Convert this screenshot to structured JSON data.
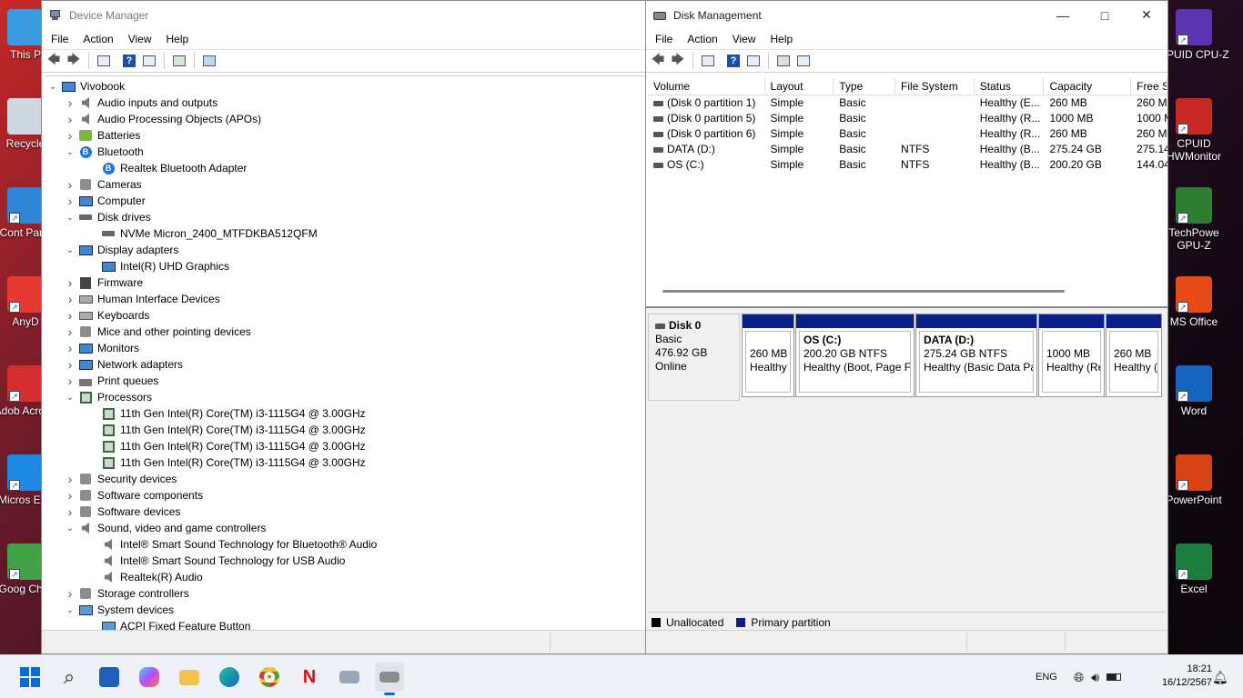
{
  "desktop": {
    "left_icons": [
      {
        "label": "This P",
        "color": "#3a9be0"
      },
      {
        "label": "Recycle",
        "color": "#cfd8e0"
      },
      {
        "label": "Cont Pane",
        "color": "#2f86d6"
      },
      {
        "label": "AnyD",
        "color": "#e53935"
      },
      {
        "label": "Adob Acroba",
        "color": "#d32f2f"
      },
      {
        "label": "Micros Edg",
        "color": "#1e88e5"
      },
      {
        "label": "Goog Chro",
        "color": "#43a047"
      }
    ],
    "right_icons": [
      {
        "label": "CPUID CPU-Z",
        "color": "#5e35b1"
      },
      {
        "label": "CPUID HWMonitor",
        "color": "#c62828"
      },
      {
        "label": "TechPowe GPU-Z",
        "color": "#2e7d32"
      },
      {
        "label": "MS Office",
        "color": "#e64a19"
      },
      {
        "label": "Word",
        "color": "#1565c0"
      },
      {
        "label": "PowerPoint",
        "color": "#d84315"
      },
      {
        "label": "Excel",
        "color": "#1b7d3e"
      }
    ]
  },
  "device_manager": {
    "title": "Device Manager",
    "menu": [
      "File",
      "Action",
      "View",
      "Help"
    ],
    "tree": [
      {
        "label": "Vivobook",
        "level": 0,
        "expanded": true,
        "icon": "computer"
      },
      {
        "label": "Audio inputs and outputs",
        "level": 1,
        "expanded": false,
        "icon": "speaker"
      },
      {
        "label": "Audio Processing Objects (APOs)",
        "level": 1,
        "expanded": false,
        "icon": "speaker"
      },
      {
        "label": "Batteries",
        "level": 1,
        "expanded": false,
        "icon": "battery"
      },
      {
        "label": "Bluetooth",
        "level": 1,
        "expanded": true,
        "icon": "bluetooth"
      },
      {
        "label": "Realtek Bluetooth Adapter",
        "level": 2,
        "icon": "bluetooth"
      },
      {
        "label": "Cameras",
        "level": 1,
        "expanded": false,
        "icon": "gray"
      },
      {
        "label": "Computer",
        "level": 1,
        "expanded": false,
        "icon": "monitor"
      },
      {
        "label": "Disk drives",
        "level": 1,
        "expanded": true,
        "icon": "disk"
      },
      {
        "label": "NVMe Micron_2400_MTFDKBA512QFM",
        "level": 2,
        "icon": "disk"
      },
      {
        "label": "Display adapters",
        "level": 1,
        "expanded": true,
        "icon": "monitor"
      },
      {
        "label": "Intel(R) UHD Graphics",
        "level": 2,
        "icon": "monitor"
      },
      {
        "label": "Firmware",
        "level": 1,
        "expanded": false,
        "icon": "firmware"
      },
      {
        "label": "Human Interface Devices",
        "level": 1,
        "expanded": false,
        "icon": "keyboard"
      },
      {
        "label": "Keyboards",
        "level": 1,
        "expanded": false,
        "icon": "keyboard"
      },
      {
        "label": "Mice and other pointing devices",
        "level": 1,
        "expanded": false,
        "icon": "gray"
      },
      {
        "label": "Monitors",
        "level": 1,
        "expanded": false,
        "icon": "monitor"
      },
      {
        "label": "Network adapters",
        "level": 1,
        "expanded": false,
        "icon": "monitor"
      },
      {
        "label": "Print queues",
        "level": 1,
        "expanded": false,
        "icon": "printer"
      },
      {
        "label": "Processors",
        "level": 1,
        "expanded": true,
        "icon": "cpu"
      },
      {
        "label": "11th Gen Intel(R) Core(TM) i3-1115G4 @ 3.00GHz",
        "level": 2,
        "icon": "cpu"
      },
      {
        "label": "11th Gen Intel(R) Core(TM) i3-1115G4 @ 3.00GHz",
        "level": 2,
        "icon": "cpu"
      },
      {
        "label": "11th Gen Intel(R) Core(TM) i3-1115G4 @ 3.00GHz",
        "level": 2,
        "icon": "cpu"
      },
      {
        "label": "11th Gen Intel(R) Core(TM) i3-1115G4 @ 3.00GHz",
        "level": 2,
        "icon": "cpu"
      },
      {
        "label": "Security devices",
        "level": 1,
        "expanded": false,
        "icon": "gray"
      },
      {
        "label": "Software components",
        "level": 1,
        "expanded": false,
        "icon": "gray"
      },
      {
        "label": "Software devices",
        "level": 1,
        "expanded": false,
        "icon": "gray"
      },
      {
        "label": "Sound, video and game controllers",
        "level": 1,
        "expanded": true,
        "icon": "speaker"
      },
      {
        "label": "Intel® Smart Sound Technology for Bluetooth® Audio",
        "level": 2,
        "icon": "speaker"
      },
      {
        "label": "Intel® Smart Sound Technology for USB Audio",
        "level": 2,
        "icon": "speaker"
      },
      {
        "label": "Realtek(R) Audio",
        "level": 2,
        "icon": "speaker"
      },
      {
        "label": "Storage controllers",
        "level": 1,
        "expanded": false,
        "icon": "gray"
      },
      {
        "label": "System devices",
        "level": 1,
        "expanded": true,
        "icon": "folder"
      },
      {
        "label": "ACPI Fixed Feature Button",
        "level": 2,
        "icon": "folder"
      }
    ]
  },
  "disk_management": {
    "title": "Disk Management",
    "menu": [
      "File",
      "Action",
      "View",
      "Help"
    ],
    "columns": [
      "Volume",
      "Layout",
      "Type",
      "File System",
      "Status",
      "Capacity",
      "Free S"
    ],
    "rows": [
      [
        "(Disk 0 partition 1)",
        "Simple",
        "Basic",
        "",
        "Healthy (E...",
        "260 MB",
        "260 M"
      ],
      [
        "(Disk 0 partition 5)",
        "Simple",
        "Basic",
        "",
        "Healthy (R...",
        "1000 MB",
        "1000 M"
      ],
      [
        "(Disk 0 partition 6)",
        "Simple",
        "Basic",
        "",
        "Healthy (R...",
        "260 MB",
        "260 M"
      ],
      [
        "DATA (D:)",
        "Simple",
        "Basic",
        "NTFS",
        "Healthy (B...",
        "275.24 GB",
        "275.14"
      ],
      [
        "OS (C:)",
        "Simple",
        "Basic",
        "NTFS",
        "Healthy (B...",
        "200.20 GB",
        "144.04"
      ]
    ],
    "disk": {
      "name": "Disk 0",
      "type": "Basic",
      "size": "476.92 GB",
      "state": "Online"
    },
    "partitions": [
      {
        "title": "",
        "size": "260 MB",
        "status": "Healthy"
      },
      {
        "title": "OS  (C:)",
        "size": "200.20 GB NTFS",
        "status": "Healthy (Boot, Page Fi"
      },
      {
        "title": "DATA  (D:)",
        "size": "275.24 GB NTFS",
        "status": "Healthy (Basic Data Pa"
      },
      {
        "title": "",
        "size": "1000 MB",
        "status": "Healthy (Re"
      },
      {
        "title": "",
        "size": "260 MB",
        "status": "Healthy ("
      }
    ],
    "legend": [
      {
        "label": "Unallocated",
        "color": "#000000"
      },
      {
        "label": "Primary partition",
        "color": "#0a1f88"
      }
    ]
  },
  "taskbar": {
    "language": "ENG",
    "time": "18:21",
    "date": "16/12/2567"
  }
}
